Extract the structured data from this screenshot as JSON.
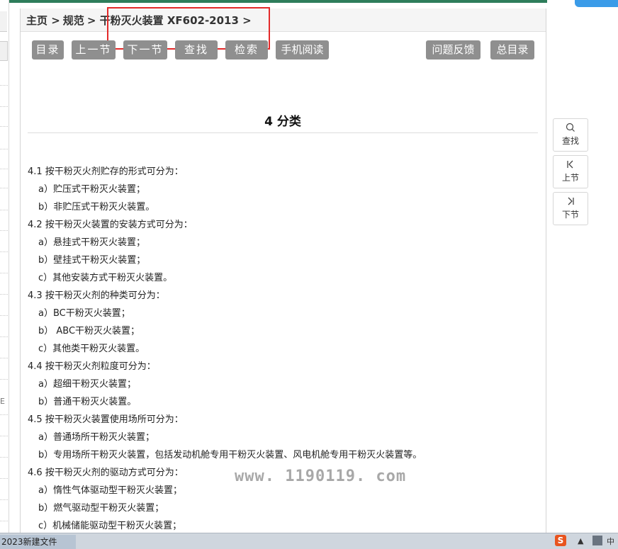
{
  "breadcrumb": {
    "home": "主页 >",
    "spec": "规范",
    "doc": "> 干粉灭火装置 XF602-2013 >"
  },
  "toolbar": {
    "toc": "目录",
    "prev": "上一节",
    "next": "下一节",
    "find": "查找",
    "search": "检索",
    "mobile": "手机阅读",
    "feedback": "问题反馈",
    "main_toc": "总目录"
  },
  "side_nav": {
    "find": "查找",
    "prev": "上节",
    "next": "下节"
  },
  "document": {
    "title": "4  分类",
    "lines": [
      {
        "text": "4.1 按干粉灭火剂贮存的形式可分为：",
        "indent": false
      },
      {
        "text": "a）贮压式干粉灭火装置；",
        "indent": true
      },
      {
        "text": "b）非贮压式干粉灭火装置。",
        "indent": true
      },
      {
        "text": "4.2 按干粉灭火装置的安装方式可分为：",
        "indent": false
      },
      {
        "text": "a）悬挂式干粉灭火装置；",
        "indent": true
      },
      {
        "text": "b）壁挂式干粉灭火装置；",
        "indent": true
      },
      {
        "text": "c）其他安装方式干粉灭火装置。",
        "indent": true
      },
      {
        "text": "4.3 按干粉灭火剂的种类可分为：",
        "indent": false
      },
      {
        "text": "a）BC干粉灭火装置；",
        "indent": true
      },
      {
        "text": "b） ABC干粉灭火装置；",
        "indent": true
      },
      {
        "text": "c）其他类干粉灭火装置。",
        "indent": true
      },
      {
        "text": "4.4 按干粉灭火剂粒度可分为：",
        "indent": false
      },
      {
        "text": "a）超细干粉灭火装置；",
        "indent": true
      },
      {
        "text": "b）普通干粉灭火装置。",
        "indent": true
      },
      {
        "text": "4.5 按干粉灭火装置使用场所可分为：",
        "indent": false
      },
      {
        "text": "a）普通场所干粉灭火装置；",
        "indent": true
      },
      {
        "text": "b）专用场所干粉灭火装置，包括发动机舱专用干粉灭火装置、风电机舱专用干粉灭火装置等。",
        "indent": true
      },
      {
        "text": "4.6 按干粉灭火剂的驱动方式可分为：",
        "indent": false
      },
      {
        "text": "a）惰性气体驱动型干粉灭火装置；",
        "indent": true
      },
      {
        "text": "b）燃气驱动型干粉灭火装置；",
        "indent": true
      },
      {
        "text": "c）机械储能驱动型干粉灭火装置；",
        "indent": true
      }
    ]
  },
  "watermark": "www. 1190119. com",
  "sidebar_fragment": "E",
  "taskbar": {
    "item": "2023新建文件",
    "tray_time": "中"
  },
  "colors": {
    "button_bg": "#8f8f8f",
    "highlight_box": "#e32a2a",
    "top_accent": "#2e7d5b"
  }
}
